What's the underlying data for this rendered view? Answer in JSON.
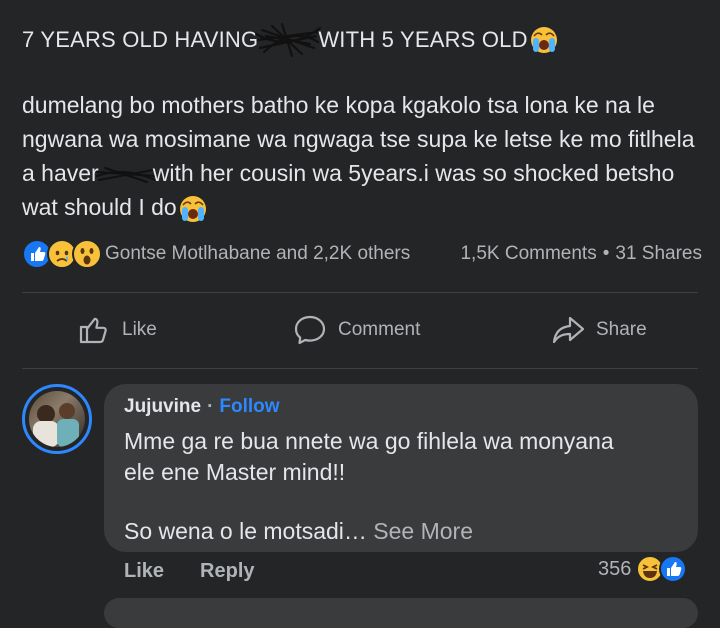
{
  "post": {
    "title_part1": "7 YEARS OLD HAVING",
    "title_part2": "WITH 5 YEARS OLD",
    "body_part1": "dumelang bo mothers batho ke kopa kgakolo tsa lona ke na le ngwana wa mosimane wa ngwaga tse supa ke letse ke mo fitlhela a haver",
    "body_part2": "with her cousin wa 5years.i was so shocked betsho wat should I do"
  },
  "reactions": {
    "names": "Gontse Motlhabane and 2,2K others",
    "comments": "1,5K Comments",
    "sep": "•",
    "shares": "31 Shares"
  },
  "actions": {
    "like": "Like",
    "comment": "Comment",
    "share": "Share"
  },
  "comment": {
    "author": "Jujuvine",
    "dot": "·",
    "follow": "Follow",
    "line1": "Mme ga re bua nnete wa go fihlela wa monyana",
    "line2": "ele ene Master mind!!",
    "line3": "So wena o le motsadi…",
    "see_more": "See More",
    "like": "Like",
    "reply": "Reply",
    "reaction_count": "356"
  },
  "colors": {
    "background": "#242526",
    "bubble": "#3a3b3c",
    "accent": "#2d88ff",
    "text": "#e4e6eb",
    "muted": "#b0b3b8"
  },
  "icons": [
    "like-reaction-icon",
    "sad-reaction-icon",
    "wow-reaction-icon",
    "crying-emoji-icon",
    "thumbs-up-icon",
    "comment-icon",
    "share-icon",
    "laugh-reaction-icon"
  ]
}
